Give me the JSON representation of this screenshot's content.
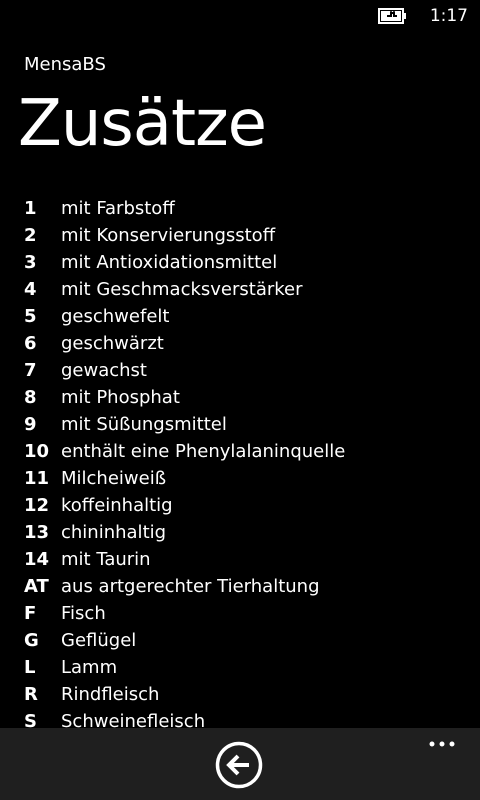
{
  "status_bar": {
    "time": "1:17",
    "battery_icon": "battery-charging-icon"
  },
  "app": {
    "name": "MensaBS"
  },
  "page": {
    "title": "Zusätze"
  },
  "additives": [
    {
      "code": "1",
      "label": "mit Farbstoff"
    },
    {
      "code": "2",
      "label": "mit Konservierungsstoff"
    },
    {
      "code": "3",
      "label": "mit Antioxidationsmittel"
    },
    {
      "code": "4",
      "label": "mit Geschmacksverstärker"
    },
    {
      "code": "5",
      "label": "geschwefelt"
    },
    {
      "code": "6",
      "label": "geschwärzt"
    },
    {
      "code": "7",
      "label": "gewachst"
    },
    {
      "code": "8",
      "label": "mit Phosphat"
    },
    {
      "code": "9",
      "label": "mit Süßungsmittel"
    },
    {
      "code": "10",
      "label": "enthält eine Phenylalaninquelle"
    },
    {
      "code": "11",
      "label": "Milcheiweiß"
    },
    {
      "code": "12",
      "label": "koffeinhaltig"
    },
    {
      "code": "13",
      "label": "chininhaltig"
    },
    {
      "code": "14",
      "label": "mit Taurin"
    },
    {
      "code": "AT",
      "label": "aus artgerechter Tierhaltung"
    },
    {
      "code": "F",
      "label": "Fisch"
    },
    {
      "code": "G",
      "label": "Geflügel"
    },
    {
      "code": "L",
      "label": "Lamm"
    },
    {
      "code": "R",
      "label": "Rindfleisch"
    },
    {
      "code": "S",
      "label": "Schweinefleisch"
    }
  ],
  "app_bar": {
    "back_icon": "back-arrow-icon",
    "more_icon": "ellipsis-icon"
  },
  "colors": {
    "background": "#000000",
    "foreground": "#ffffff",
    "app_bar": "#1f1f1f"
  }
}
